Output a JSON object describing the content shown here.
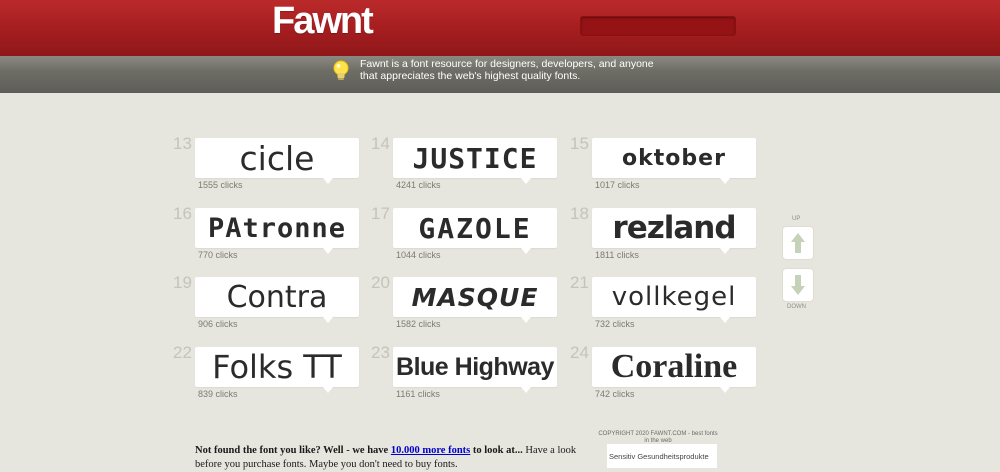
{
  "header": {
    "logo": "Fawnt",
    "search_placeholder": "",
    "tagline": "Fawnt is a font resource for designers, developers, and anyone that appreciates the web's highest quality fonts."
  },
  "fonts": [
    {
      "number": "13",
      "name": "cicle",
      "clicks": "1555 clicks"
    },
    {
      "number": "14",
      "name": "JUSTICE",
      "clicks": "4241 clicks"
    },
    {
      "number": "15",
      "name": "oktober",
      "clicks": "1017 clicks"
    },
    {
      "number": "16",
      "name": "PAtronne",
      "clicks": "770 clicks"
    },
    {
      "number": "17",
      "name": "GAZOLE",
      "clicks": "1044 clicks"
    },
    {
      "number": "18",
      "name": "rezland",
      "clicks": "1811 clicks"
    },
    {
      "number": "19",
      "name": "Contra",
      "clicks": "906 clicks"
    },
    {
      "number": "20",
      "name": "MASQUE",
      "clicks": "1582 clicks"
    },
    {
      "number": "21",
      "name": "vollkegel",
      "clicks": "732 clicks"
    },
    {
      "number": "22",
      "name": "Folks TT",
      "clicks": "839 clicks"
    },
    {
      "number": "23",
      "name": "Blue Highway",
      "clicks": "1161 clicks"
    },
    {
      "number": "24",
      "name": "Coraline",
      "clicks": "742 clicks"
    }
  ],
  "pager": {
    "up_label": "UP",
    "down_label": "DOWN"
  },
  "footer": {
    "lead": "Not found the font you like? Well - we have",
    "link": "10.000 more fonts",
    "after_link": "to look at...",
    "rest": "Have a look before you purchase fonts. Maybe you don't need to buy fonts.",
    "copyright_line1": "COPYRIGHT 2020 FAWNT.COM - best fonts",
    "copyright_line2": "in the web",
    "ad_text": "Sensitiv Gesundheitsprodukte"
  },
  "colors": {
    "header_red": "#a41d1f",
    "tagbar_gray": "#6e6e67",
    "background": "#e6e5de",
    "link_blue": "#0000cc"
  }
}
